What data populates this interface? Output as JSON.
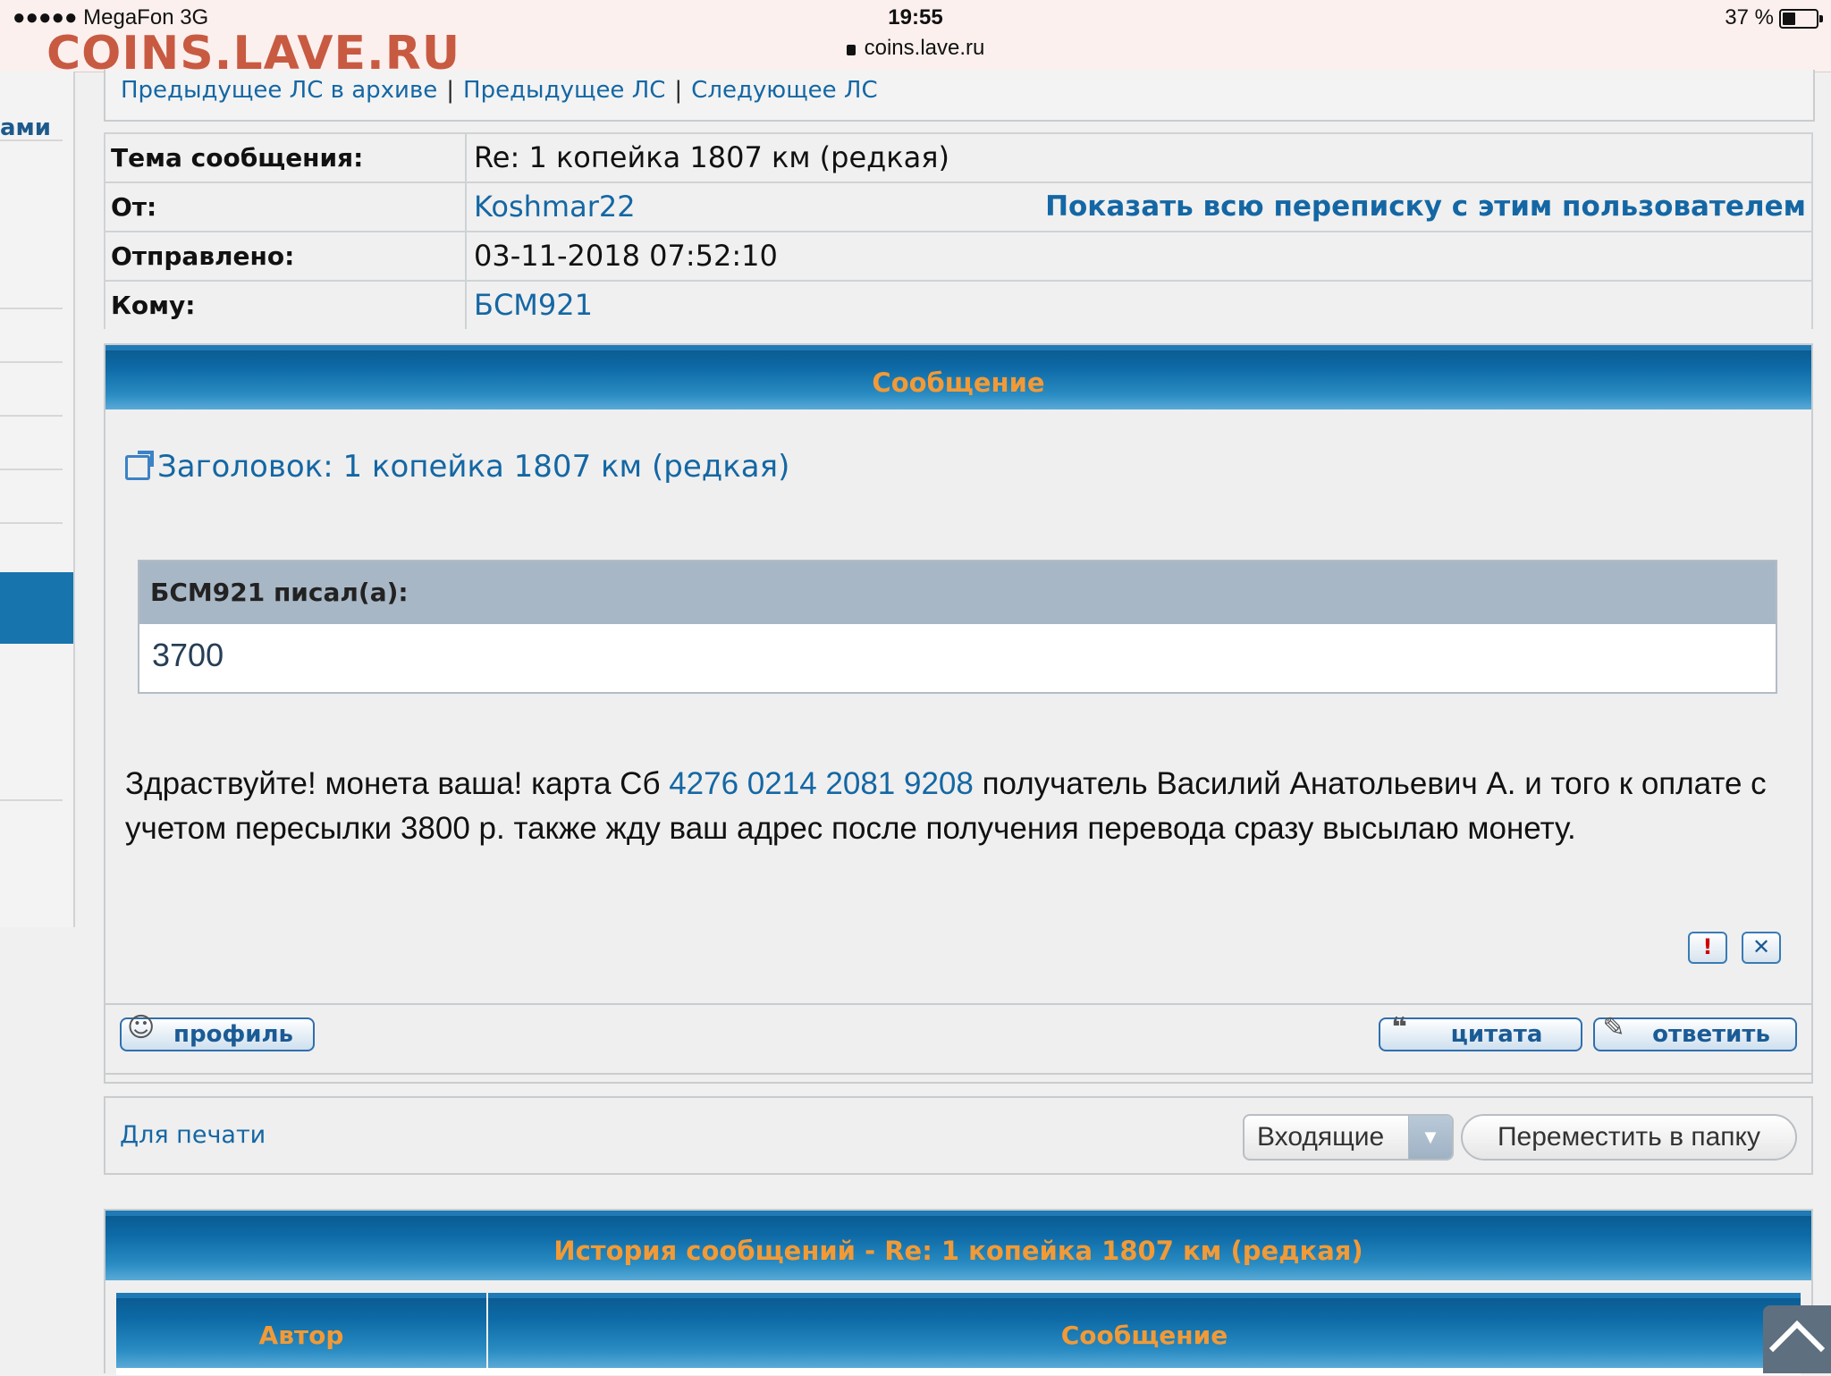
{
  "status_bar": {
    "carrier": "●●●●● MegaFon   3G",
    "time": "19:55",
    "battery": "37 %",
    "url": "coins.lave.ru"
  },
  "watermark": "COINS.LAVE.RU",
  "sidebar": {
    "partial_text": "ами"
  },
  "nav": {
    "prev_archive": "Предыдущее ЛС в архиве",
    "prev": "Предыдущее ЛС",
    "next": "Следующее ЛС",
    "separator": "|"
  },
  "info": {
    "subject_label": "Тема сообщения:",
    "subject_value": "Re: 1 копейка 1807 км (редкая)",
    "from_label": "От:",
    "from_value": "Koshmar22",
    "show_all": "Показать всю переписку с этим пользователем",
    "sent_label": "Отправлено:",
    "sent_value": "03-11-2018 07:52:10",
    "to_label": "Кому:",
    "to_value": "БСМ921"
  },
  "message": {
    "header": "Сообщение",
    "title": "Заголовок: 1 копейка 1807 км (редкая)",
    "quote_author": "БСМ921 писал(а):",
    "quote_text": "3700",
    "body_part1": "Здраствуйте! монета ваша! карта Сб ",
    "card_number": "4276 0214 2081 9208",
    "body_part2": " получатель Василий Анатольевич А. и того к оплате с учетом пересылки 3800 р. также жду ваш адрес после получения перевода сразу высылаю монету.",
    "report_icon": "!",
    "delete_icon": "✕",
    "profile_button": "профиль",
    "quote_button": "цитата",
    "reply_button": "ответить"
  },
  "actions": {
    "print_link": "Для печати",
    "folder_selected": "Входящие",
    "move_button": "Переместить в папку"
  },
  "history": {
    "header": "История сообщений - Re: 1 копейка 1807 км (редкая)",
    "col_author": "Автор",
    "col_message": "Сообщение"
  },
  "colors": {
    "link": "#1467a4",
    "header_text": "#f29a36",
    "header_bar": "#0d6aa6",
    "watermark": "#c85a42"
  }
}
